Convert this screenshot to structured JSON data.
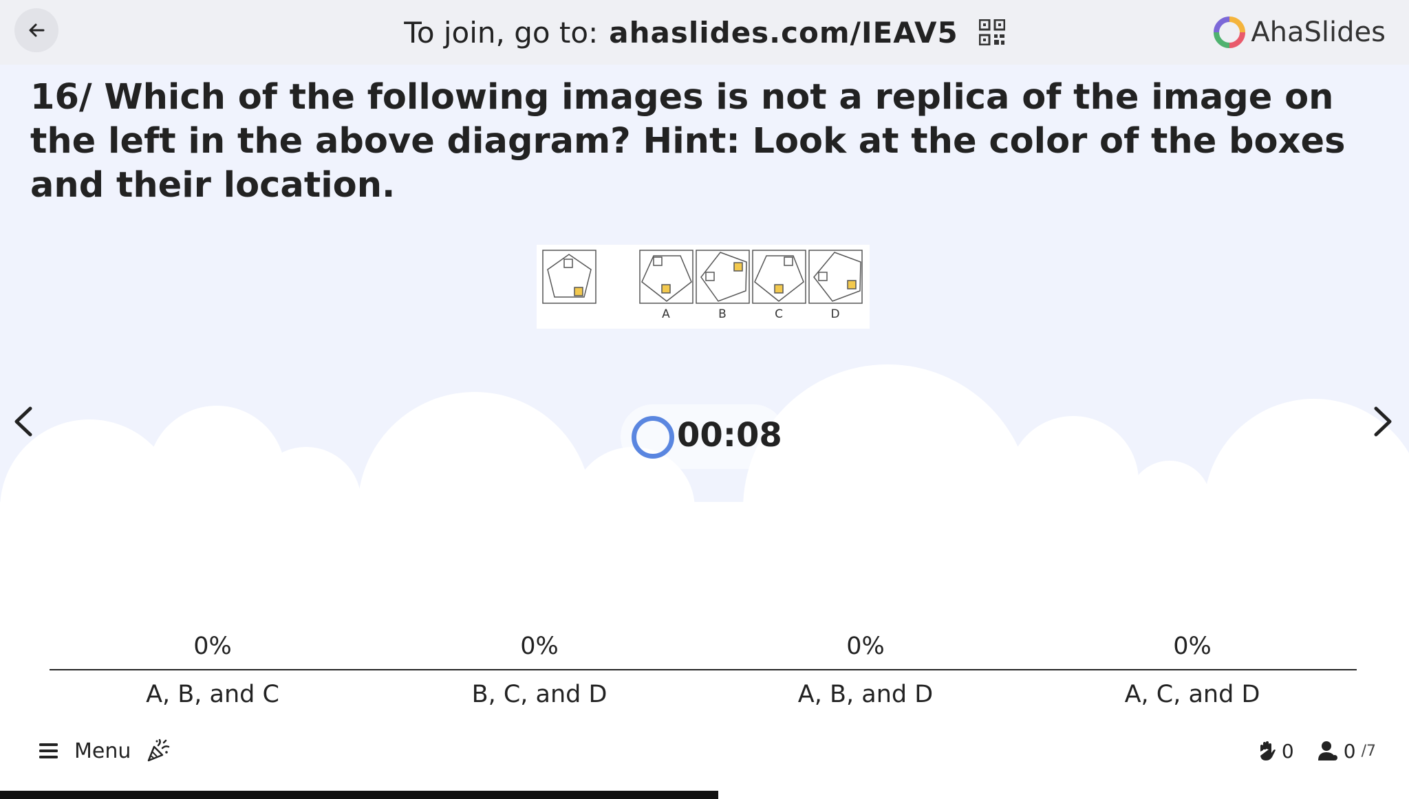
{
  "header": {
    "join_prefix": "To join, go to:",
    "join_url": "ahaslides.com/IEAV5",
    "brand": "AhaSlides"
  },
  "question": {
    "text": "16/ Which of the following images is not a replica of the image on the left in the above diagram? Hint: Look at the color of the boxes and their location."
  },
  "figure": {
    "labels": [
      "A",
      "B",
      "C",
      "D"
    ]
  },
  "timer": {
    "value": "00:08"
  },
  "results": [
    {
      "percent": "0%",
      "option": "A, B, and C"
    },
    {
      "percent": "0%",
      "option": "B, C, and D"
    },
    {
      "percent": "0%",
      "option": "A, B, and D"
    },
    {
      "percent": "0%",
      "option": "A, C, and D"
    }
  ],
  "footer": {
    "menu_label": "Menu",
    "hands_count": "0",
    "participants_count": "0",
    "participants_total": "/7"
  },
  "progress": {
    "fraction": 0.51
  },
  "colors": {
    "accent": "#5a86e0",
    "highlight_box": "#f3c94e",
    "background": "#f0f3fd"
  },
  "icons": [
    "back-arrow-icon",
    "qr-code-icon",
    "ahaslides-logo",
    "chevron-left-icon",
    "chevron-right-icon",
    "menu-icon",
    "party-popper-icon",
    "raised-hand-icon",
    "participant-icon"
  ]
}
